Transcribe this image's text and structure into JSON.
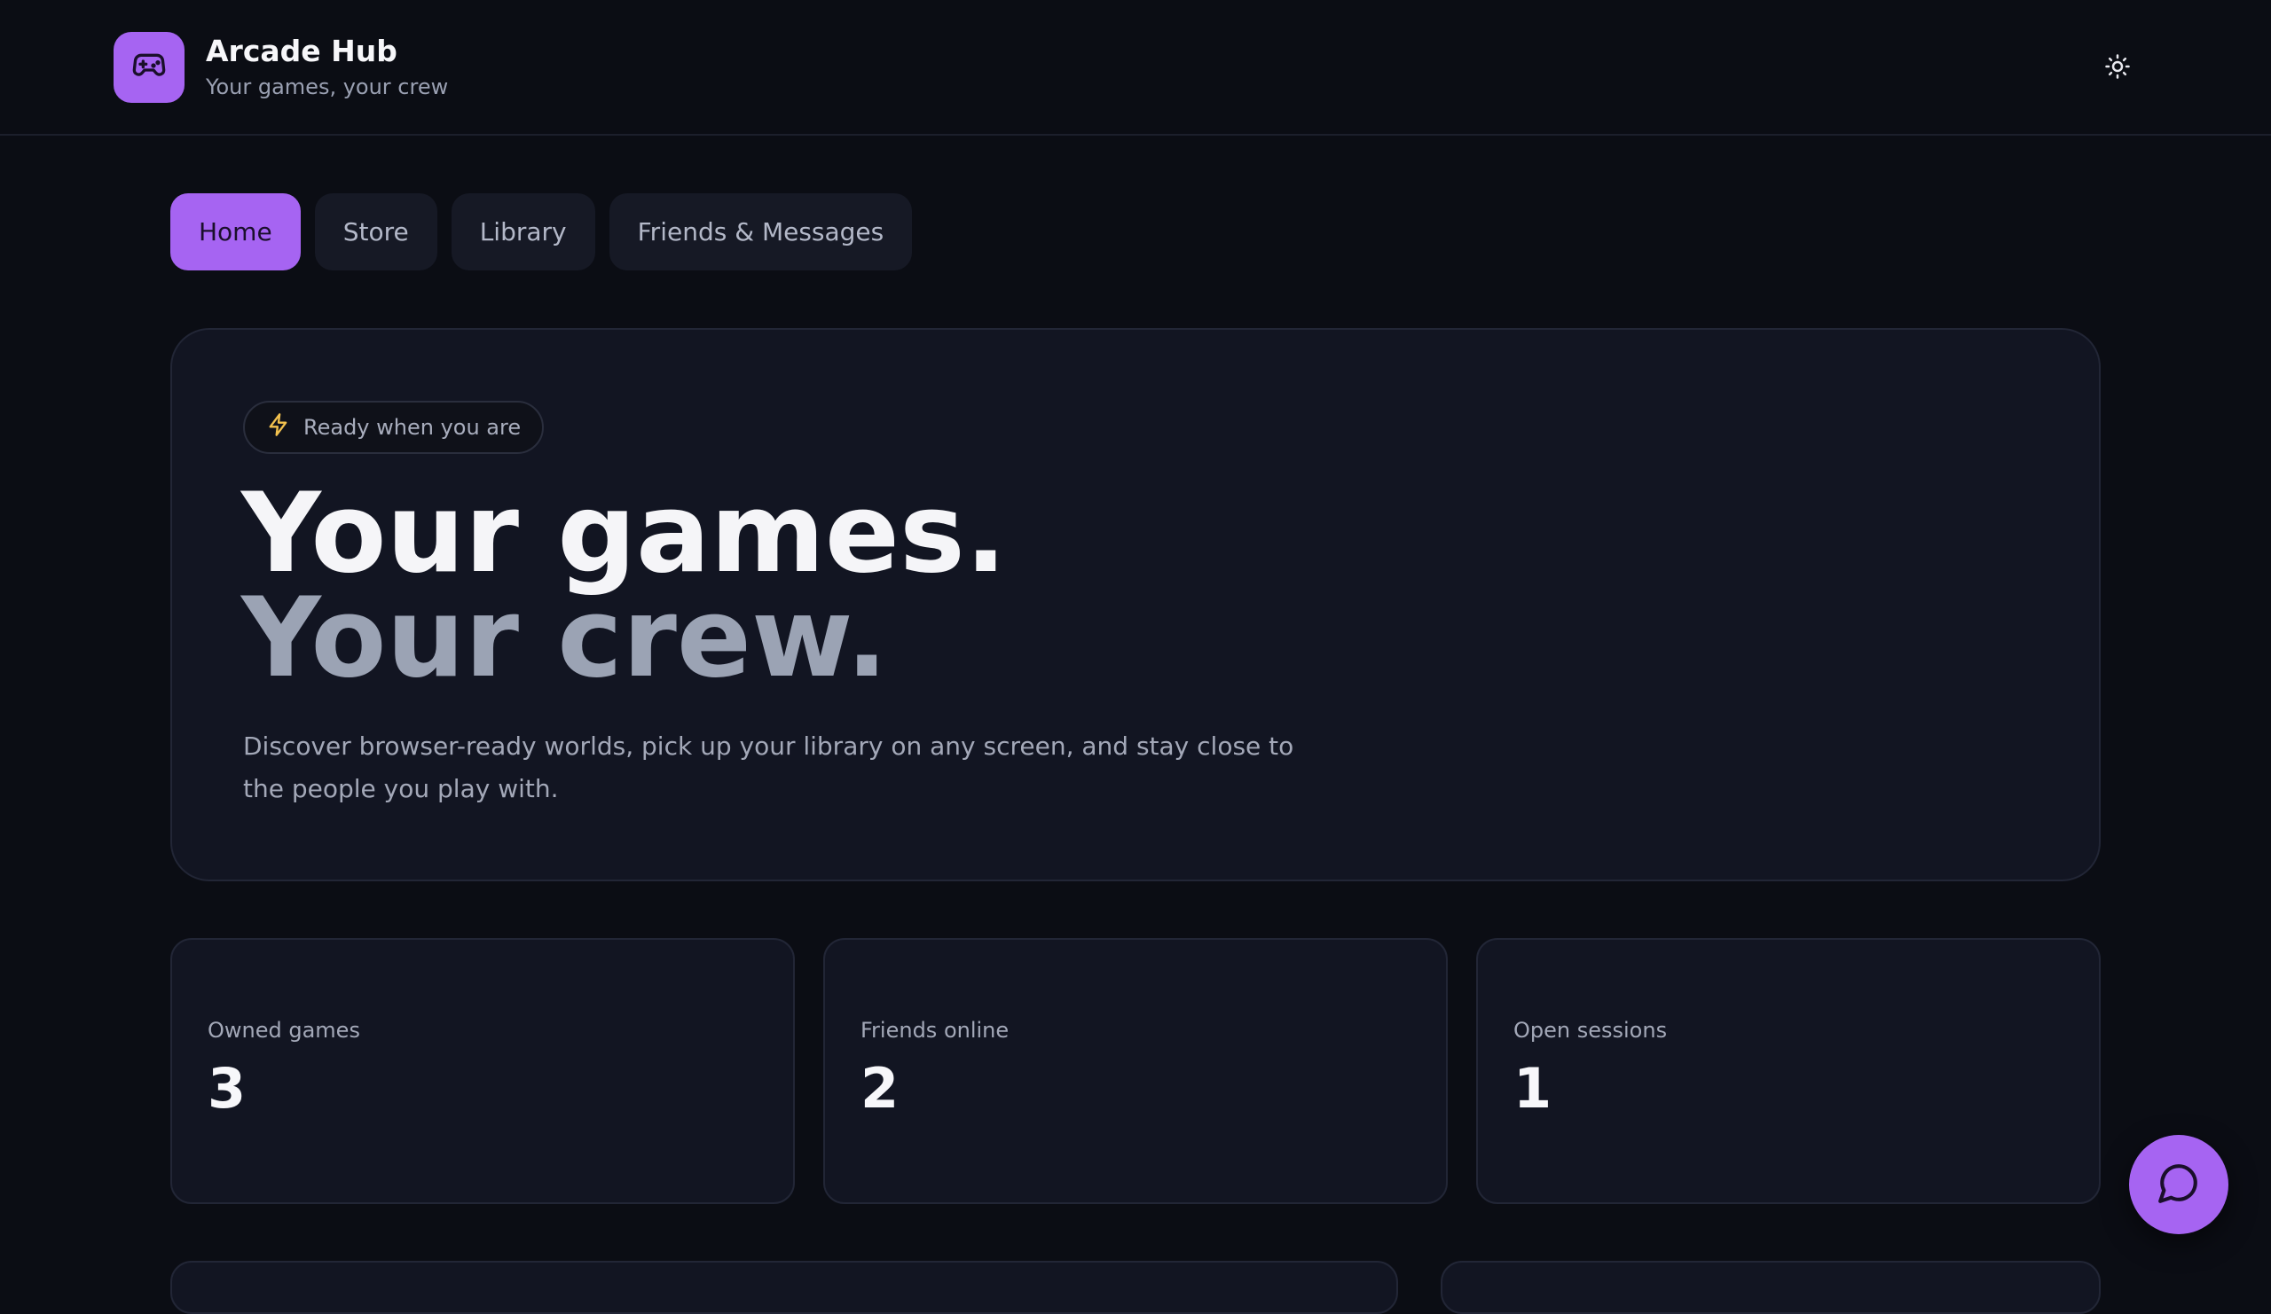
{
  "app": {
    "title": "Arcade Hub",
    "subtitle": "Your games, your crew",
    "logo_icon": "gamepad-icon",
    "theme_icon": "sun-icon"
  },
  "tabs": [
    {
      "label": "Home",
      "active": true
    },
    {
      "label": "Store",
      "active": false
    },
    {
      "label": "Library",
      "active": false
    },
    {
      "label": "Friends & Messages",
      "active": false
    }
  ],
  "hero": {
    "badge_icon": "lightning-icon",
    "badge_text": "Ready when you are",
    "headline_line1": "Your games.",
    "headline_line2": "Your crew.",
    "description": "Discover browser-ready worlds, pick up your library on any screen, and stay close to the people you play with."
  },
  "stats": [
    {
      "label": "Owned games",
      "value": "3"
    },
    {
      "label": "Friends online",
      "value": "2"
    },
    {
      "label": "Open sessions",
      "value": "1"
    }
  ],
  "chat_fab": {
    "icon": "chat-bubble-icon"
  },
  "colors": {
    "accent": "#a664f2",
    "background": "#0b0d14",
    "card": "#121522",
    "badge_icon": "#f2c14e"
  }
}
